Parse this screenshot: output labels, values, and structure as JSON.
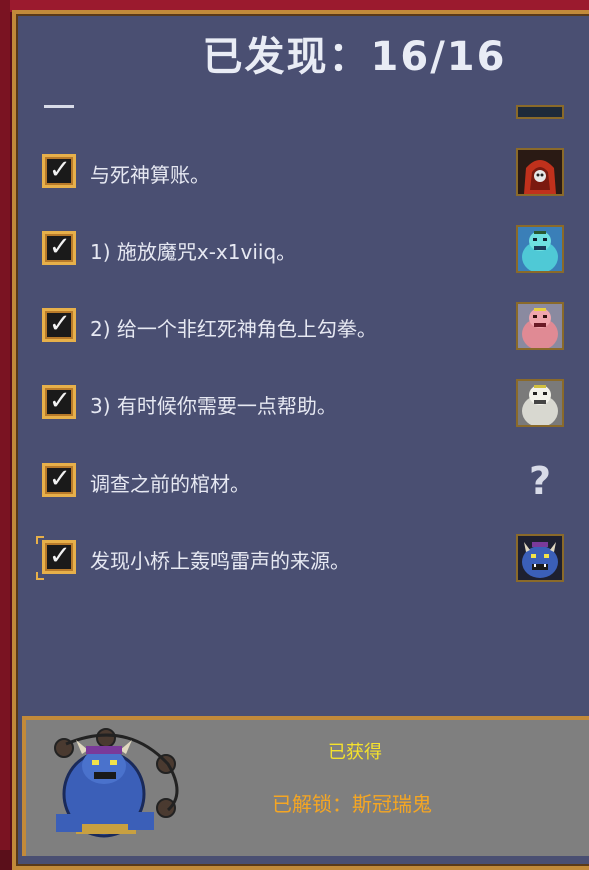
{
  "header": {
    "title": "已发现：16/16"
  },
  "quests": [
    {
      "label": "与死神算账。",
      "checked": true,
      "thumb": "red-hooded-reaper-portrait"
    },
    {
      "label": "1) 施放魔咒x-x1viiq。",
      "checked": true,
      "thumb": "cyan-ogre-portrait"
    },
    {
      "label": "2) 给一个非红死神角色上勾拳。",
      "checked": true,
      "thumb": "pink-ogre-portrait"
    },
    {
      "label": "3) 有时候你需要一点帮助。",
      "checked": true,
      "thumb": "white-ogre-portrait"
    },
    {
      "label": "调查之前的棺材。",
      "checked": true,
      "thumb": "question-mark",
      "thumb_text": "?"
    },
    {
      "label": "发现小桥上轰鸣雷声的来源。",
      "checked": true,
      "thumb": "blue-oni-portrait"
    }
  ],
  "reward": {
    "obtained": "已获得",
    "unlocked": "已解锁：斯冠瑞鬼"
  },
  "colors": {
    "panel": "#4a4f72",
    "frame": "#c28a3a",
    "obtained_text": "#f5e22c",
    "unlocked_text": "#f5a623"
  }
}
